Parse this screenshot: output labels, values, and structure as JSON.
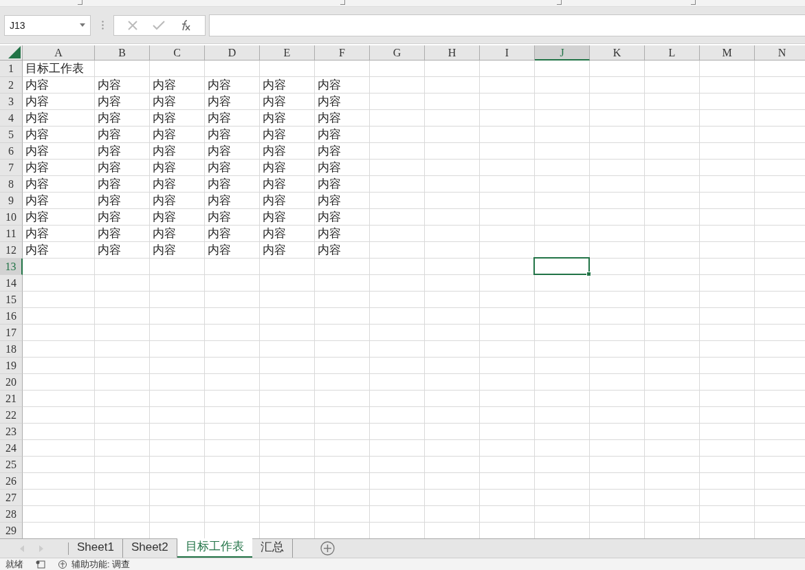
{
  "name_box": "J13",
  "columns": [
    {
      "label": "A",
      "selected": false
    },
    {
      "label": "B",
      "selected": false
    },
    {
      "label": "C",
      "selected": false
    },
    {
      "label": "D",
      "selected": false
    },
    {
      "label": "E",
      "selected": false
    },
    {
      "label": "F",
      "selected": false
    },
    {
      "label": "G",
      "selected": false
    },
    {
      "label": "H",
      "selected": false
    },
    {
      "label": "I",
      "selected": false
    },
    {
      "label": "J",
      "selected": true
    },
    {
      "label": "K",
      "selected": false
    },
    {
      "label": "L",
      "selected": false
    },
    {
      "label": "M",
      "selected": false
    },
    {
      "label": "N",
      "selected": false
    }
  ],
  "rows": [
    {
      "label": "1",
      "selected": false,
      "cells": [
        "目标工作表"
      ]
    },
    {
      "label": "2",
      "selected": false,
      "cells": [
        "内容",
        "内容",
        "内容",
        "内容",
        "内容",
        "内容"
      ]
    },
    {
      "label": "3",
      "selected": false,
      "cells": [
        "内容",
        "内容",
        "内容",
        "内容",
        "内容",
        "内容"
      ]
    },
    {
      "label": "4",
      "selected": false,
      "cells": [
        "内容",
        "内容",
        "内容",
        "内容",
        "内容",
        "内容"
      ]
    },
    {
      "label": "5",
      "selected": false,
      "cells": [
        "内容",
        "内容",
        "内容",
        "内容",
        "内容",
        "内容"
      ]
    },
    {
      "label": "6",
      "selected": false,
      "cells": [
        "内容",
        "内容",
        "内容",
        "内容",
        "内容",
        "内容"
      ]
    },
    {
      "label": "7",
      "selected": false,
      "cells": [
        "内容",
        "内容",
        "内容",
        "内容",
        "内容",
        "内容"
      ]
    },
    {
      "label": "8",
      "selected": false,
      "cells": [
        "内容",
        "内容",
        "内容",
        "内容",
        "内容",
        "内容"
      ]
    },
    {
      "label": "9",
      "selected": false,
      "cells": [
        "内容",
        "内容",
        "内容",
        "内容",
        "内容",
        "内容"
      ]
    },
    {
      "label": "10",
      "selected": false,
      "cells": [
        "内容",
        "内容",
        "内容",
        "内容",
        "内容",
        "内容"
      ]
    },
    {
      "label": "11",
      "selected": false,
      "cells": [
        "内容",
        "内容",
        "内容",
        "内容",
        "内容",
        "内容"
      ]
    },
    {
      "label": "12",
      "selected": false,
      "cells": [
        "内容",
        "内容",
        "内容",
        "内容",
        "内容",
        "内容"
      ]
    },
    {
      "label": "13",
      "selected": true
    },
    {
      "label": "14",
      "selected": false
    },
    {
      "label": "15",
      "selected": false
    },
    {
      "label": "16",
      "selected": false
    },
    {
      "label": "17",
      "selected": false
    },
    {
      "label": "18",
      "selected": false
    },
    {
      "label": "19",
      "selected": false
    },
    {
      "label": "20",
      "selected": false
    },
    {
      "label": "21",
      "selected": false
    },
    {
      "label": "22",
      "selected": false
    },
    {
      "label": "23",
      "selected": false
    },
    {
      "label": "24",
      "selected": false
    },
    {
      "label": "25",
      "selected": false
    },
    {
      "label": "26",
      "selected": false
    },
    {
      "label": "27",
      "selected": false
    },
    {
      "label": "28",
      "selected": false
    },
    {
      "label": "29",
      "selected": false
    }
  ],
  "sheet_tabs": [
    {
      "label": "Sheet1",
      "selected": false
    },
    {
      "label": "Sheet2",
      "selected": false
    },
    {
      "label": "目标工作表",
      "selected": true
    },
    {
      "label": "汇总",
      "selected": false
    }
  ],
  "status_bar": {
    "ready": "就绪",
    "accessibility": "辅助功能: 调查"
  }
}
